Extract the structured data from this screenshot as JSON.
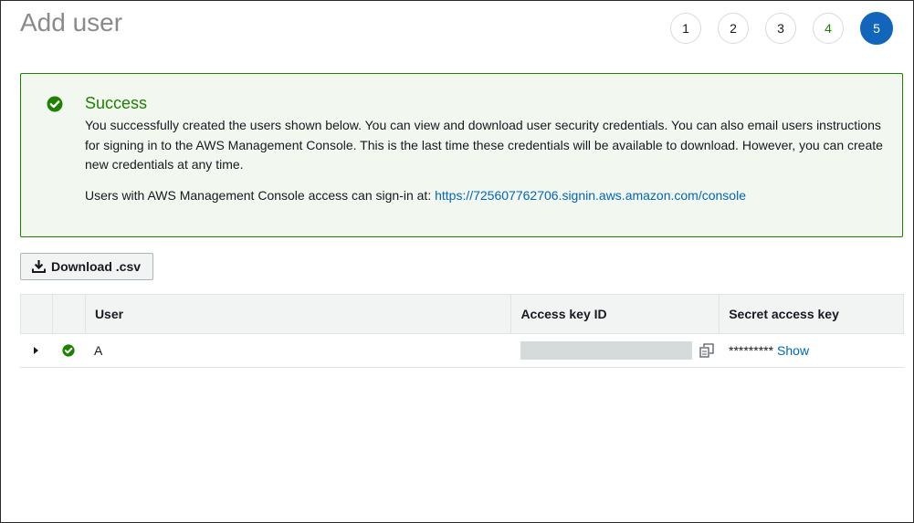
{
  "page": {
    "title": "Add user"
  },
  "steps": [
    "1",
    "2",
    "3",
    "4",
    "5"
  ],
  "alert": {
    "title": "Success",
    "body": "You successfully created the users shown below. You can view and download user security credentials. You can also email users instructions for signing in to the AWS Management Console. This is the last time these credentials will be available to download. However, you can create new credentials at any time.",
    "signin_prefix": "Users with AWS Management Console access can sign-in at: ",
    "signin_url": "https://725607762706.signin.aws.amazon.com/console"
  },
  "toolbar": {
    "download_label": "Download .csv"
  },
  "table": {
    "headers": [
      "User",
      "Access key ID",
      "Secret access key"
    ],
    "rows": [
      {
        "user": "A",
        "secret_mask": "*********",
        "show_label": "Show"
      }
    ]
  },
  "colors": {
    "success": "#1d8102",
    "active_step": "#1166bb",
    "link": "#0066bb"
  }
}
